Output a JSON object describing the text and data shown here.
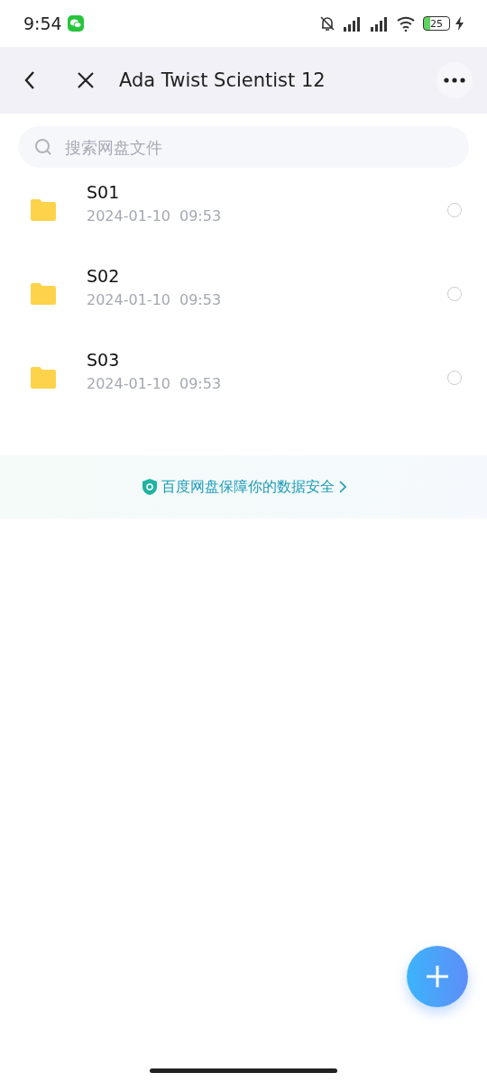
{
  "status_bar": {
    "time": "9:54",
    "battery": "25"
  },
  "header": {
    "title": "Ada Twist Scientist 12"
  },
  "search": {
    "placeholder": "搜索网盘文件"
  },
  "files": [
    {
      "name": "S01",
      "date": "2024-01-10",
      "time": "09:53",
      "selected": false
    },
    {
      "name": "S02",
      "date": "2024-01-10",
      "time": "09:53",
      "selected": false
    },
    {
      "name": "S03",
      "date": "2024-01-10",
      "time": "09:53",
      "selected": false
    }
  ],
  "banner": {
    "text": "百度网盘保障你的数据安全"
  }
}
